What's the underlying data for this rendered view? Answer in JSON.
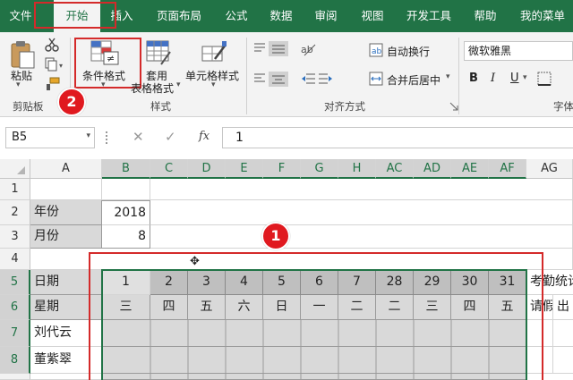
{
  "menu": {
    "tabs": [
      "文件",
      "开始",
      "插入",
      "页面布局",
      "公式",
      "数据",
      "审阅",
      "视图",
      "开发工具",
      "帮助",
      "我的菜单"
    ],
    "active_index": 1
  },
  "ribbon": {
    "clipboard": {
      "paste_label": "粘贴",
      "group_label": "剪贴板"
    },
    "styles": {
      "cond_format_label": "条件格式",
      "table_format_label_1": "套用",
      "table_format_label_2": "表格格式",
      "cell_style_label": "单元格样式",
      "group_label": "样式"
    },
    "alignment": {
      "wrap_label": "自动换行",
      "merge_label": "合并后居中",
      "group_label": "对齐方式"
    },
    "font": {
      "font_name": "微软雅黑",
      "bold": "B",
      "italic": "I",
      "underline": "U",
      "group_label": "字体"
    }
  },
  "formula_bar": {
    "name_box": "B5",
    "formula": "1",
    "fx": "fx"
  },
  "badges": {
    "one": "1",
    "two": "2"
  },
  "grid": {
    "columns": [
      "A",
      "B",
      "C",
      "D",
      "E",
      "F",
      "G",
      "H",
      "AC",
      "AD",
      "AE",
      "AF",
      "AG"
    ],
    "rows": [
      "1",
      "2",
      "3",
      "4",
      "5",
      "6",
      "7",
      "8"
    ],
    "year_label": "年份",
    "year_value": "2018",
    "month_label": "月份",
    "month_value": "8",
    "date_label": "日期",
    "weekday_label": "星期",
    "days": [
      "1",
      "2",
      "3",
      "4",
      "5",
      "6",
      "7",
      "28",
      "29",
      "30",
      "31"
    ],
    "weekdays": [
      "三",
      "四",
      "五",
      "六",
      "日",
      "一",
      "二",
      "二",
      "三",
      "四",
      "五"
    ],
    "stats_label": "考勤统计",
    "leave_label": "请假",
    "out_label": "出",
    "names": [
      "刘代云",
      "董紫翠"
    ]
  },
  "colors": {
    "accent": "#217346",
    "highlight": "#d42a2a"
  }
}
